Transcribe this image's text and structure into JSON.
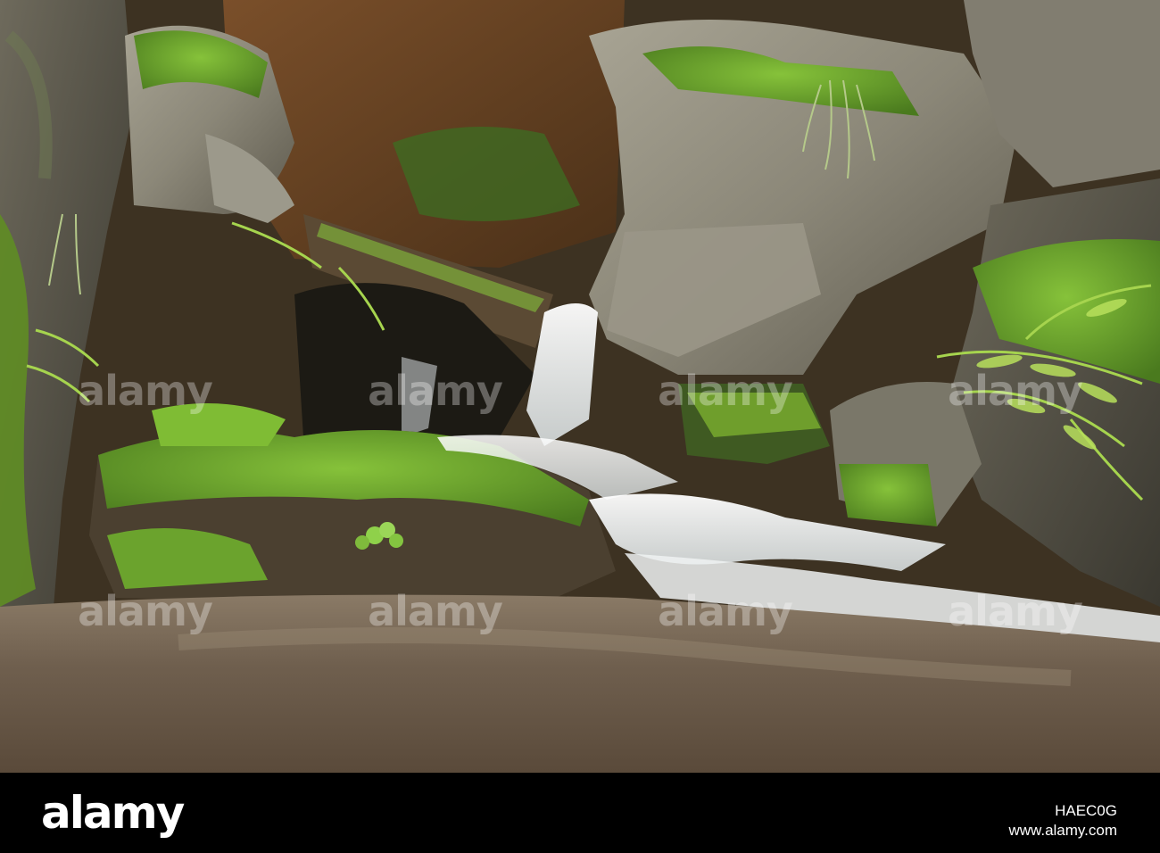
{
  "photo": {
    "subject": "waterfall-over-mossy-rocks",
    "colors": {
      "moss": "#6fae2e",
      "rock": "#8d8a7c",
      "water_foam": "#f2f4f4",
      "pool": "#7a6a55",
      "forest_floor": "#6b4424"
    }
  },
  "watermark": {
    "text": "alamy"
  },
  "footer": {
    "brand": "alamy",
    "image_id": "HAEC0G",
    "site": "www.alamy.com"
  }
}
